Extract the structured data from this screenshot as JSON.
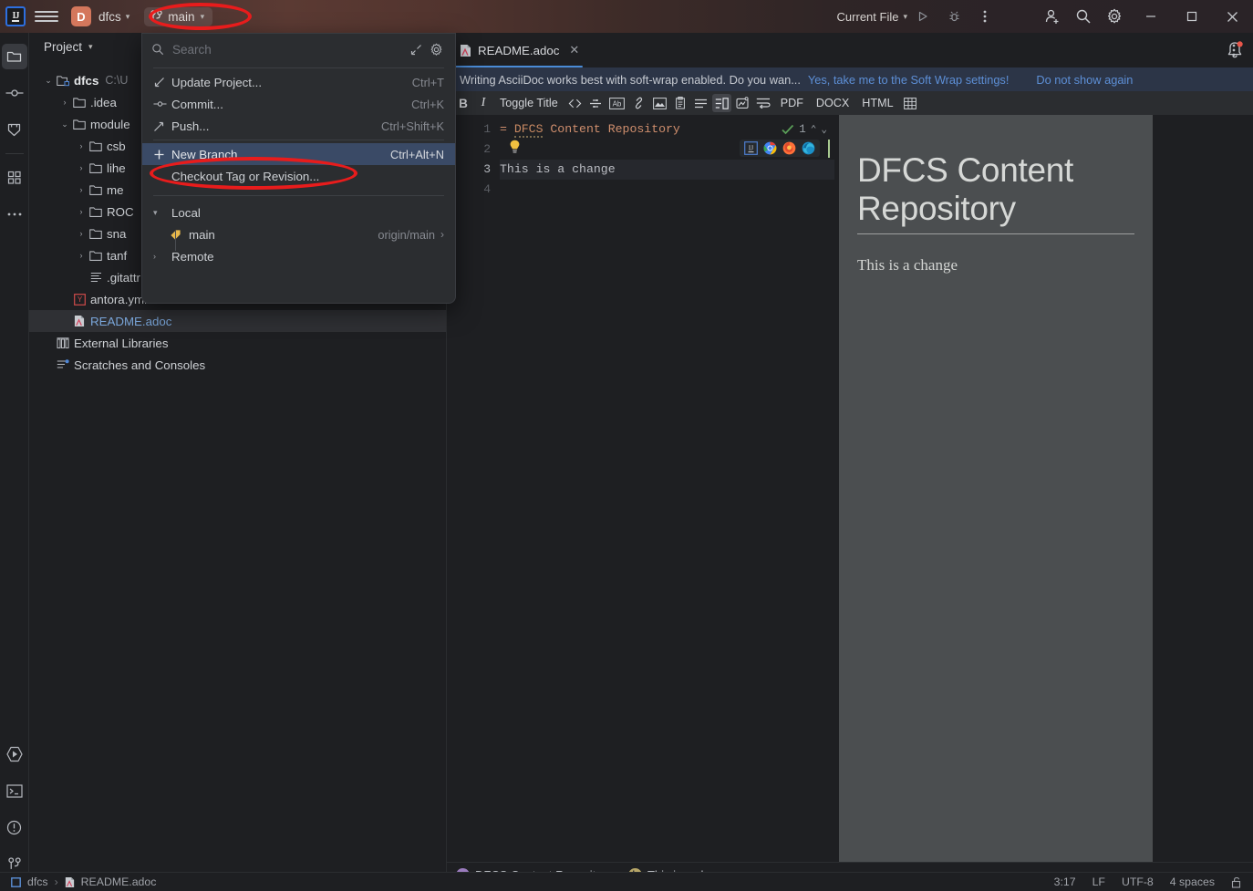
{
  "titlebar": {
    "logo": "IJ",
    "menu_icon": "hamburger-menu-icon",
    "project_initial": "D",
    "project_name": "dfcs",
    "branch_icon": "git-branch-icon",
    "branch_name": "main",
    "run_config": "Current File",
    "icons": [
      "run-icon",
      "debug-icon",
      "more-actions-icon",
      "add-collaborator-icon",
      "search-everywhere-icon",
      "settings-icon"
    ],
    "window_min": "—",
    "window_max": "□",
    "window_close": "✕"
  },
  "rail": {
    "top": [
      "project-folder-icon",
      "commit-icon",
      "pull-requests-icon"
    ],
    "mid": [
      "structure-icon",
      "more-tool-windows-icon"
    ],
    "bottom": [
      "run-icon",
      "terminal-icon",
      "problems-icon",
      "git-icon"
    ]
  },
  "project_panel": {
    "title": "Project",
    "tree": [
      {
        "indent": 0,
        "arrow": "⌄",
        "icon": "module-icon",
        "label": "dfcs",
        "sub": "C:\\U",
        "bold": true,
        "selected": false
      },
      {
        "indent": 1,
        "arrow": "›",
        "icon": "folder-icon",
        "label": ".idea",
        "sub": "",
        "bold": false,
        "selected": false
      },
      {
        "indent": 1,
        "arrow": "⌄",
        "icon": "folder-icon",
        "label": "module",
        "sub": "",
        "bold": false,
        "selected": false
      },
      {
        "indent": 2,
        "arrow": "›",
        "icon": "folder-icon",
        "label": "csb",
        "sub": "",
        "bold": false,
        "selected": false
      },
      {
        "indent": 2,
        "arrow": "›",
        "icon": "folder-icon",
        "label": "lihe",
        "sub": "",
        "bold": false,
        "selected": false
      },
      {
        "indent": 2,
        "arrow": "›",
        "icon": "folder-icon",
        "label": "me",
        "sub": "",
        "bold": false,
        "selected": false
      },
      {
        "indent": 2,
        "arrow": "›",
        "icon": "folder-icon",
        "label": "ROC",
        "sub": "",
        "bold": false,
        "selected": false
      },
      {
        "indent": 2,
        "arrow": "›",
        "icon": "folder-icon",
        "label": "sna",
        "sub": "",
        "bold": false,
        "selected": false
      },
      {
        "indent": 2,
        "arrow": "›",
        "icon": "folder-icon",
        "label": "tanf",
        "sub": "",
        "bold": false,
        "selected": false
      },
      {
        "indent": 2,
        "arrow": "",
        "icon": "text-file-icon",
        "label": ".gitattr",
        "sub": "",
        "bold": false,
        "selected": false
      },
      {
        "indent": 1,
        "arrow": "",
        "icon": "yaml-file-icon",
        "label": "antora.yml",
        "sub": "",
        "bold": false,
        "selected": false
      },
      {
        "indent": 1,
        "arrow": "",
        "icon": "asciidoc-file-icon",
        "label": "README.adoc",
        "sub": "",
        "bold": false,
        "selected": true
      },
      {
        "indent": 0,
        "arrow": "",
        "icon": "libraries-icon",
        "label": "External Libraries",
        "sub": "",
        "bold": false,
        "selected": false
      },
      {
        "indent": 0,
        "arrow": "",
        "icon": "scratches-icon",
        "label": "Scratches and Consoles",
        "sub": "",
        "bold": false,
        "selected": false
      }
    ]
  },
  "branch_popup": {
    "search_placeholder": "Search",
    "search_icon": "search-icon",
    "expand_icon": "expand-icon",
    "settings_icon": "gear-icon",
    "actions": [
      {
        "icon": "update-project-icon",
        "label": "Update Project...",
        "shortcut": "Ctrl+T",
        "highlighted": false
      },
      {
        "icon": "commit-icon",
        "label": "Commit...",
        "shortcut": "Ctrl+K",
        "highlighted": false
      },
      {
        "icon": "push-icon",
        "label": "Push...",
        "shortcut": "Ctrl+Shift+K",
        "highlighted": false
      }
    ],
    "branch_actions": [
      {
        "icon": "plus-icon",
        "label": "New Branch...",
        "shortcut": "Ctrl+Alt+N",
        "highlighted": true
      },
      {
        "icon": "",
        "label": "Checkout Tag or Revision...",
        "shortcut": "",
        "highlighted": false
      }
    ],
    "local_group": "Local",
    "local_branches": [
      {
        "icon": "branch-tag-icon",
        "name": "main",
        "tracking": "origin/main",
        "chevron": "›"
      }
    ],
    "remote_group": "Remote"
  },
  "editor": {
    "tab": {
      "label": "README.adoc",
      "icon": "asciidoc-file-icon",
      "close": "✕"
    },
    "more_icon": "more-options-icon",
    "notification_icon": "notifications-bell-icon",
    "notification": {
      "message": "Writing AsciiDoc works best with soft-wrap enabled. Do you wan...",
      "action": "Yes, take me to the Soft Wrap settings!",
      "dismiss": "Do not show again"
    },
    "toolbar": {
      "bold": "B",
      "italic": "I",
      "toggle_title": "Toggle Title",
      "icons": [
        "code-icon",
        "strikethrough-icon",
        "attributes-icon",
        "link-icon",
        "image-icon",
        "clipboard-icon",
        "list-icon",
        "layout-icon",
        "diagram-icon",
        "soft-wrap-icon"
      ],
      "pdf": "PDF",
      "docx": "DOCX",
      "html": "HTML",
      "table_icon": "table-icon"
    },
    "code": {
      "lines": [
        {
          "num": "1",
          "prefix": "= ",
          "title": "DFCS",
          "rest": " Content Repository",
          "current": false
        },
        {
          "num": "2",
          "prefix": "",
          "title": "",
          "rest": "",
          "current": false
        },
        {
          "num": "3",
          "prefix": "",
          "title": "",
          "rest": "This is a change",
          "current": true
        },
        {
          "num": "4",
          "prefix": "",
          "title": "",
          "rest": "",
          "current": false
        }
      ],
      "inspection_count": "1",
      "inspection_icon": "inspection-ok-icon",
      "up_icon": "⌃",
      "down_icon": "⌄",
      "bulb_icon": "intention-bulb-icon",
      "browsers": [
        "intellij-preview-icon",
        "chrome-icon",
        "firefox-icon",
        "edge-icon"
      ]
    },
    "preview": {
      "heading": "DFCS Content Repository",
      "paragraph": "This is a change"
    },
    "breadcrumbs": [
      {
        "badge": "s",
        "badge_color": "#9a7bbd",
        "label": "DFCS Content Repository"
      },
      {
        "badge": "b",
        "badge_color": "#b6a567",
        "label": "This is a change"
      }
    ]
  },
  "statusbar": {
    "project_icon": "project-icon",
    "project": "dfcs",
    "separator": "›",
    "file_icon": "asciidoc-file-icon",
    "file": "README.adoc",
    "position": "3:17",
    "line_sep": "LF",
    "encoding": "UTF-8",
    "indent": "4 spaces",
    "lock_icon": "unlocked-icon"
  },
  "annotations": {
    "ellipse_color": "#e81c1c"
  }
}
